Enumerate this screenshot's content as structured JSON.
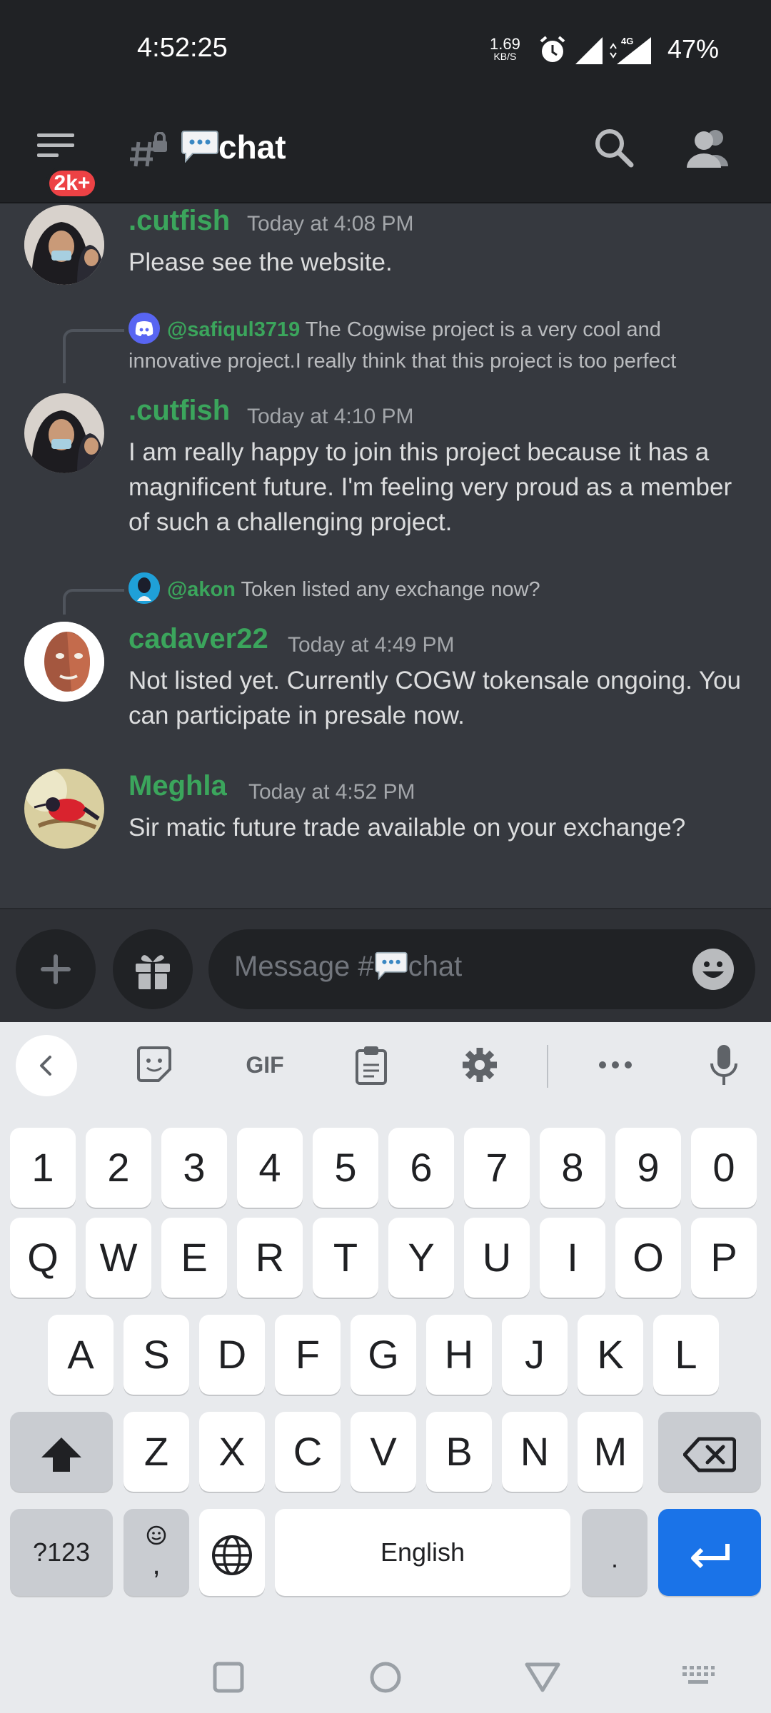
{
  "status_bar": {
    "time": "4:52:25",
    "net_speed": "1.69",
    "net_unit": "KB/S",
    "net_type": "4G",
    "battery": "47%"
  },
  "header": {
    "unread_badge": "2k+",
    "channel_name": "chat"
  },
  "messages": [
    {
      "author": ".cutfish",
      "timestamp": "Today at 4:08 PM",
      "text": "Please see the website."
    },
    {
      "reply_to": {
        "user": "@safiqul3719",
        "text": "The  Cogwise project  is a very cool and innovative project.I really think  that this project is too perfect"
      },
      "author": ".cutfish",
      "timestamp": "Today at 4:10 PM",
      "text": "I am really happy to join this project because it has a magnificent future. I'm feeling very proud as a member of such a challenging project."
    },
    {
      "reply_to": {
        "user": "@akon",
        "text": "Token listed any exchange now?"
      },
      "author": "cadaver22",
      "timestamp": "Today at 4:49 PM",
      "text": "Not listed yet. Currently COGW tokensale ongoing. You can participate in presale now."
    },
    {
      "author": "Meghla",
      "timestamp": "Today at 4:52 PM",
      "text": "Sir matic future trade available on your exchange?"
    }
  ],
  "composer": {
    "placeholder_prefix": "Message #",
    "placeholder_channel": "chat"
  },
  "keyboard": {
    "toolbar": {
      "gif": "GIF"
    },
    "rows": [
      [
        "1",
        "2",
        "3",
        "4",
        "5",
        "6",
        "7",
        "8",
        "9",
        "0"
      ],
      [
        "Q",
        "W",
        "E",
        "R",
        "T",
        "Y",
        "U",
        "I",
        "O",
        "P"
      ],
      [
        "A",
        "S",
        "D",
        "F",
        "G",
        "H",
        "J",
        "K",
        "L"
      ],
      [
        "Z",
        "X",
        "C",
        "V",
        "B",
        "N",
        "M"
      ]
    ],
    "symbols_key": "?123",
    "comma_key": ",",
    "space_key": "English",
    "period_key": "."
  },
  "colors": {
    "brand_green": "#3ba55c",
    "badge_red": "#ed4245",
    "enter_blue": "#1a73e8",
    "discord_blurple": "#5865f2"
  },
  "icons": [
    "menu-icon",
    "hash-lock-icon",
    "speech-bubble-icon",
    "search-icon",
    "members-icon",
    "plus-icon",
    "gift-icon",
    "smiley-icon",
    "back-chevron-icon",
    "sticker-icon",
    "clipboard-icon",
    "settings-icon",
    "more-icon",
    "mic-icon",
    "shift-icon",
    "backspace-icon",
    "globe-icon",
    "enter-icon",
    "recents-icon",
    "home-icon",
    "back-icon",
    "keyboard-hide-icon"
  ]
}
